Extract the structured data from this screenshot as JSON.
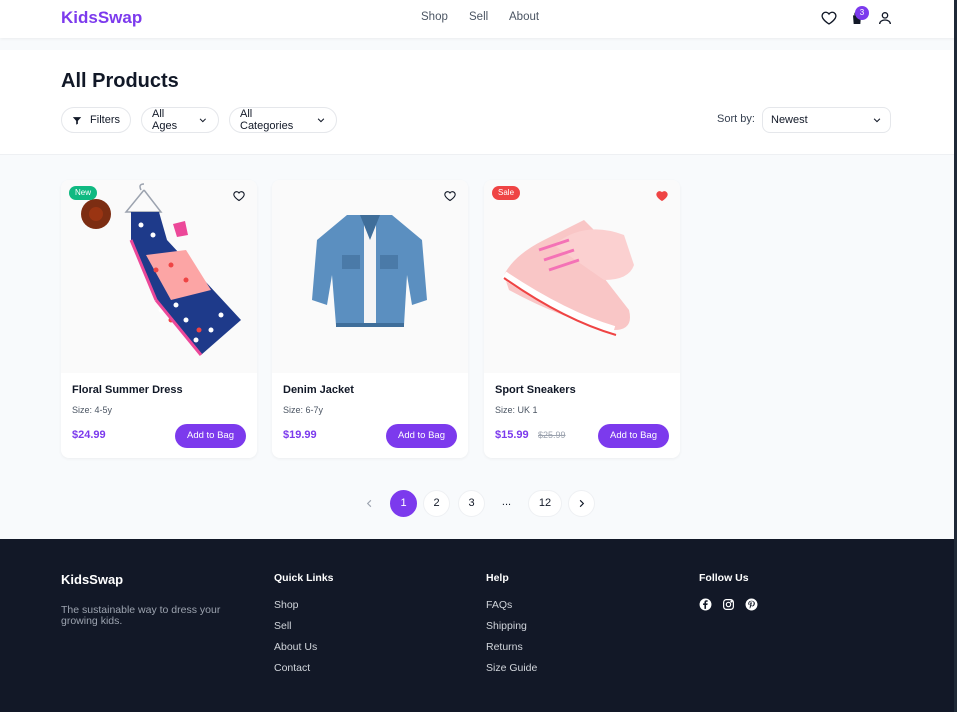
{
  "header": {
    "logo": "KidsSwap",
    "nav": [
      "Shop",
      "Sell",
      "About"
    ],
    "cart_count": "3",
    "icons": [
      "heart-icon",
      "shopping-bag-icon",
      "user-icon"
    ]
  },
  "page": {
    "title": "All Products",
    "filters_label": "Filters",
    "ages": "All Ages",
    "categories": "All Categories",
    "sort_label": "Sort by:",
    "sort_value": "Newest"
  },
  "products": [
    {
      "name": "Floral Summer Dress",
      "size": "Size: 4-5y",
      "price": "$24.99",
      "old_price": "",
      "badge": "New",
      "badge_color": "#10b981",
      "favorited": false,
      "button": "Add to Bag"
    },
    {
      "name": "Denim Jacket",
      "size": "Size: 6-7y",
      "price": "$19.99",
      "old_price": "",
      "badge": "",
      "badge_color": "",
      "favorited": false,
      "button": "Add to Bag"
    },
    {
      "name": "Sport Sneakers",
      "size": "Size: UK 1",
      "price": "$15.99",
      "old_price": "$25.99",
      "badge": "Sale",
      "badge_color": "#ef4444",
      "favorited": true,
      "button": "Add to Bag"
    }
  ],
  "pagination": {
    "pages": [
      "1",
      "2",
      "3",
      "...",
      "12"
    ],
    "current": "1"
  },
  "footer": {
    "logo": "KidsSwap",
    "tagline": "The sustainable way to dress your growing kids.",
    "quick_links_title": "Quick Links",
    "quick_links": [
      "Shop",
      "Sell",
      "About Us",
      "Contact"
    ],
    "help_title": "Help",
    "help_links": [
      "FAQs",
      "Shipping",
      "Returns",
      "Size Guide"
    ],
    "follow_title": "Follow Us",
    "social": [
      "facebook-icon",
      "instagram-icon",
      "pinterest-icon"
    ]
  },
  "colors": {
    "brand": "#7c3aed",
    "footer_bg": "#121827",
    "new_badge": "#10b981",
    "sale_badge": "#ef4444"
  }
}
